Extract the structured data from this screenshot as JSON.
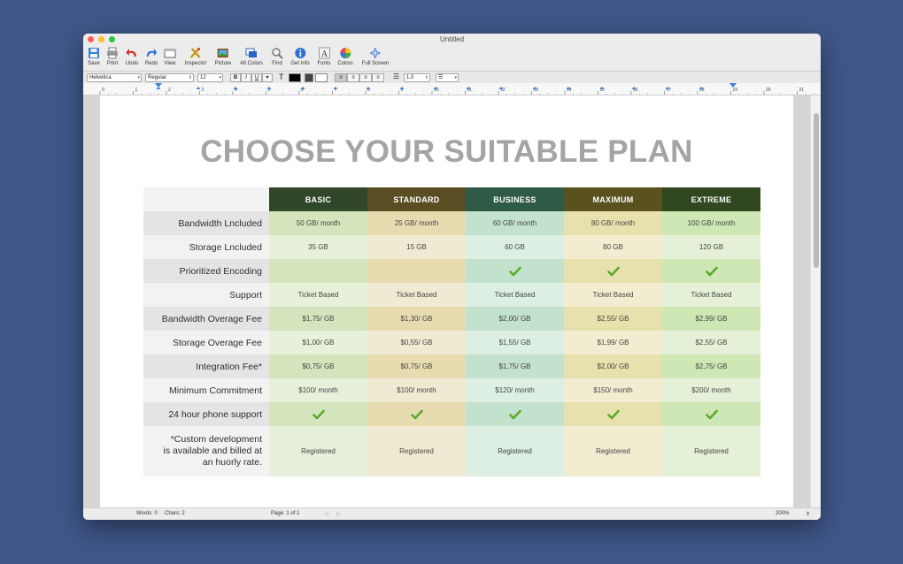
{
  "window": {
    "title": "Untitled"
  },
  "toolbar": [
    {
      "label": "Save",
      "icon": "save-icon"
    },
    {
      "label": "Print",
      "icon": "print-icon"
    },
    {
      "label": "Undo",
      "icon": "undo-icon"
    },
    {
      "label": "Redo",
      "icon": "redo-icon"
    },
    {
      "label": "View",
      "icon": "view-icon"
    },
    {
      "label": "Inspector",
      "icon": "inspector-icon"
    },
    {
      "label": "Picture",
      "icon": "picture-icon"
    },
    {
      "label": "Alt Colors",
      "icon": "alt-colors-icon"
    },
    {
      "label": "Find",
      "icon": "find-icon"
    },
    {
      "label": "Get Info",
      "icon": "info-icon"
    },
    {
      "label": "Fonts",
      "icon": "fonts-icon"
    },
    {
      "label": "Colors",
      "icon": "colors-icon"
    },
    {
      "label": "Full Screen",
      "icon": "full-screen-icon"
    }
  ],
  "format": {
    "font_family": "Helvetica",
    "font_style": "Regular",
    "font_size": "12",
    "bold": "B",
    "italic": "I",
    "underline": "U",
    "text_color_label": "T",
    "line_spacing": "1.0"
  },
  "ruler": {
    "numbers": [
      "0",
      "1",
      "2",
      "3",
      "4",
      "5",
      "6",
      "7",
      "8",
      "9",
      "10",
      "11",
      "12",
      "13",
      "14",
      "15",
      "16",
      "17",
      "18",
      "19",
      "20",
      "21"
    ]
  },
  "document": {
    "heading": "CHOOSE YOUR SUITABLE PLAN",
    "plans": [
      "BASIC",
      "STANDARD",
      "BUSINESS",
      "MAXIMUM",
      "EXTREME"
    ],
    "rows": [
      {
        "label": "Bandwidth Lncluded",
        "values": [
          "50 GB/ month",
          "25 GB/ month",
          "60 GB/ month",
          "80 GB/ month",
          "100 GB/ month"
        ]
      },
      {
        "label": "Storage Lncluded",
        "values": [
          "35 GB",
          "15 GB",
          "60 GB",
          "80 GB",
          "120 GB"
        ]
      },
      {
        "label": "Prioritized Encoding",
        "values": [
          "",
          "",
          "check",
          "check",
          "check"
        ]
      },
      {
        "label": "Support",
        "values": [
          "Ticket Based",
          "Ticket Based",
          "Ticket Based",
          "Ticket Based",
          "Ticket Based"
        ]
      },
      {
        "label": "Bandwidth Overage Fee",
        "values": [
          "$1,75/ GB",
          "$1,30/ GB",
          "$2,00/ GB",
          "$2,55/ GB",
          "$2,99/ GB"
        ]
      },
      {
        "label": "Storage Overage Fee",
        "values": [
          "$1,00/ GB",
          "$0,55/ GB",
          "$1,55/ GB",
          "$1,99/ GB",
          "$2,55/ GB"
        ]
      },
      {
        "label": "Integration Fee*",
        "values": [
          "$0,75/ GB",
          "$0,75/ GB",
          "$1,75/ GB",
          "$2,00/ GB",
          "$2,75/ GB"
        ]
      },
      {
        "label": "Minimum Commitment",
        "values": [
          "$100/ month",
          "$100/ month",
          "$120/ month",
          "$150/ month",
          "$200/ month"
        ]
      },
      {
        "label": "24 hour phone support",
        "values": [
          "check",
          "check",
          "check",
          "check",
          "check"
        ]
      },
      {
        "label": "*Custom development\nis available and billed at\nan huorly rate.",
        "values": [
          "Registered",
          "Registered",
          "Registered",
          "Registered",
          "Registered"
        ]
      }
    ]
  },
  "colors": {
    "plan_headers": [
      "#30472a",
      "#5a4d23",
      "#2f5a45",
      "#59511e",
      "#30471f"
    ],
    "check": "#5aaa2c"
  },
  "status": {
    "words": "Words: 0",
    "chars": "Chars: 2",
    "page": "Page: 1 of 1",
    "zoom": "200%"
  }
}
